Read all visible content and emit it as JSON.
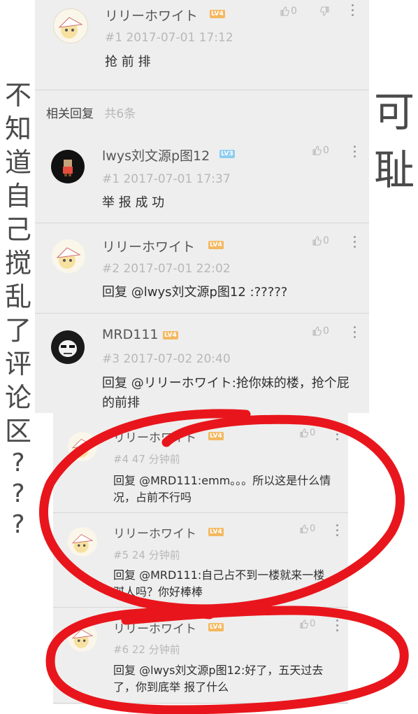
{
  "top_comment": {
    "username": "リリーホワイト",
    "level": "LV4",
    "meta": "#1  2017-07-01 17:12",
    "text": "抢 前 排",
    "likes": "0"
  },
  "related": {
    "title": "相关回复",
    "count": "共6条"
  },
  "replies": [
    {
      "username": "lwys刘文源p图12",
      "level": "LV3",
      "meta": "#1  2017-07-01 17:37",
      "text": "举 报 成 功",
      "likes": "0"
    },
    {
      "username": "リリーホワイト",
      "level": "LV4",
      "meta": "#2  2017-07-01 22:02",
      "text": "回复 @lwys刘文源p图12 :?????",
      "likes": "0"
    },
    {
      "username": "MRD111",
      "level": "LV4",
      "meta": "#3  2017-07-02 20:40",
      "text": "回复 @リリーホワイト:抢你妹的楼，抢个屁的前排",
      "likes": "0"
    },
    {
      "username": "リリーホワイト",
      "level": "LV4",
      "meta": "#4  47 分钟前",
      "text": "回复 @MRD111:emm。。。所以这是什么情况，占前不行吗",
      "likes": "0"
    },
    {
      "username": "リリーホワイト",
      "level": "LV4",
      "meta": "#5  24 分钟前",
      "text": "回复 @MRD111:自己占不到一楼就来一楼怼人吗？你好棒棒",
      "likes": "0"
    },
    {
      "username": "リリーホワイト",
      "level": "LV4",
      "meta": "#6  22 分钟前",
      "text": "回复 @lwys刘文源p图12:好了，五天过去了，你到底举 报了什么",
      "likes": "0"
    }
  ],
  "handwriting": {
    "left_vertical": [
      "不",
      "知",
      "道",
      "自",
      "己",
      "搅",
      "乱",
      "了",
      "评",
      "论",
      "区",
      "?",
      "?",
      "?"
    ],
    "right_vertical": [
      "可",
      "耻"
    ]
  },
  "colors": {
    "panel": "#eeeeee",
    "annotation_red": "#e8161c",
    "level_badge": "#f4b860",
    "level_badge_lv3": "#8ccdf0"
  }
}
